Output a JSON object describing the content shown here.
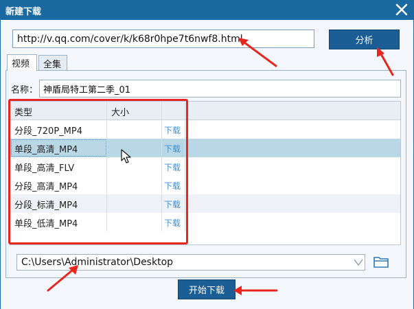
{
  "window": {
    "title": "新建下载"
  },
  "url_input": {
    "value": "http://v.qq.com/cover/k/k68r0hpe7t6nwf8.html"
  },
  "analyze_button": {
    "label": "分析"
  },
  "tabs": [
    {
      "label": "视频",
      "active": true
    },
    {
      "label": "全集",
      "active": false
    }
  ],
  "name_field": {
    "label": "名称：",
    "value": "神盾局特工第二季_01"
  },
  "table": {
    "columns": [
      "类型",
      "大小",
      ""
    ],
    "rows": [
      {
        "type": "分段_720P_MP4",
        "size": "",
        "action": "下载"
      },
      {
        "type": "单段_高清_MP4",
        "size": "",
        "action": "下载",
        "selected": true
      },
      {
        "type": "单段_高清_FLV",
        "size": "",
        "action": "下载"
      },
      {
        "type": "分段_高清_MP4",
        "size": "",
        "action": "下载"
      },
      {
        "type": "分段_标清_MP4",
        "size": "",
        "action": "下载"
      },
      {
        "type": "单段_低清_MP4",
        "size": "",
        "action": "下载"
      }
    ]
  },
  "save_path": {
    "value": "C:\\Users\\Administrator\\Desktop"
  },
  "start_button": {
    "label": "开始下载"
  },
  "colors": {
    "titlebar": "#1b69a1",
    "button": "#1b5e96",
    "annotation": "#e8261e",
    "link": "#3d8fd0",
    "selected_row": "#bad7e6"
  },
  "icons": {
    "close": "close-icon",
    "folder": "folder-icon",
    "dropdown": "chevron-down-icon",
    "pointer": "mouse-cursor-icon"
  }
}
